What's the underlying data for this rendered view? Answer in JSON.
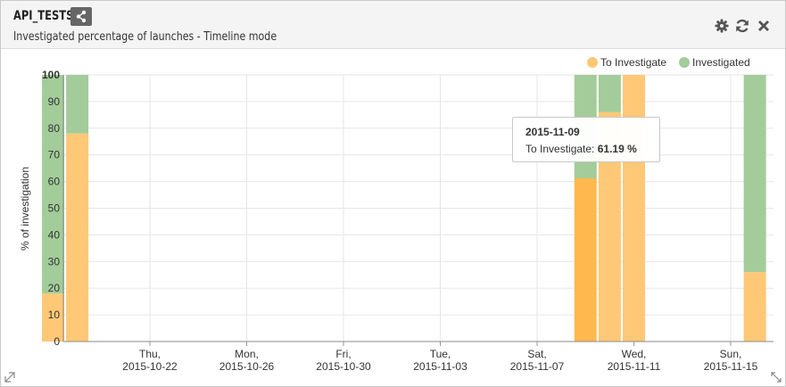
{
  "widget": {
    "title": "API_TESTS",
    "subtitle": "Investigated percentage of launches - Timeline mode"
  },
  "icons": {
    "share": "share-icon",
    "settings": "gear-icon",
    "refresh": "refresh-icon",
    "close": "close-icon"
  },
  "colors": {
    "to_investigate": "#ffc876",
    "to_investigate_active": "#ffb84d",
    "investigated": "#a3cc9a"
  },
  "tooltip": {
    "date": "2015-11-09",
    "label": "To Investigate:",
    "value": "61.19 %"
  },
  "chart_data": {
    "type": "bar",
    "stacked": true,
    "ylabel": "% of investigation",
    "ylim": [
      0,
      100
    ],
    "yticks": [
      0,
      10,
      20,
      30,
      40,
      50,
      60,
      70,
      80,
      90,
      100
    ],
    "x_tick_labels": [
      [
        "Thu,",
        "2015-10-22"
      ],
      [
        "Mon,",
        "2015-10-26"
      ],
      [
        "Fri,",
        "2015-10-30"
      ],
      [
        "Tue,",
        "2015-11-03"
      ],
      [
        "Sat,",
        "2015-11-07"
      ],
      [
        "Wed,",
        "2015-11-11"
      ],
      [
        "Sun,",
        "2015-11-15"
      ]
    ],
    "x_tick_dates": [
      "2015-10-22",
      "2015-10-26",
      "2015-10-30",
      "2015-11-03",
      "2015-11-07",
      "2015-11-11",
      "2015-11-15"
    ],
    "grid": true,
    "legend_position": "top-right",
    "series": [
      {
        "name": "To Investigate",
        "color": "#ffc876"
      },
      {
        "name": "Investigated",
        "color": "#a3cc9a"
      }
    ],
    "bars": [
      {
        "date": "2015-10-18",
        "to_investigate": 18,
        "investigated": 82
      },
      {
        "date": "2015-10-19",
        "to_investigate": 78,
        "investigated": 22
      },
      {
        "date": "2015-11-09",
        "to_investigate": 61.19,
        "investigated": 38.81,
        "active": true
      },
      {
        "date": "2015-11-10",
        "to_investigate": 86,
        "investigated": 14
      },
      {
        "date": "2015-11-11",
        "to_investigate": 100,
        "investigated": 0
      },
      {
        "date": "2015-11-16",
        "to_investigate": 26,
        "investigated": 74
      }
    ]
  }
}
